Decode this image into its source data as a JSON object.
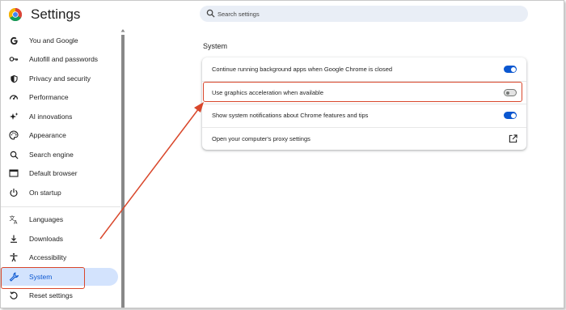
{
  "header": {
    "title": "Settings",
    "search_placeholder": "Search settings"
  },
  "sidebar": {
    "items": [
      {
        "label": "You and Google",
        "icon": "google-g-icon"
      },
      {
        "label": "Autofill and passwords",
        "icon": "key-icon"
      },
      {
        "label": "Privacy and security",
        "icon": "shield-icon"
      },
      {
        "label": "Performance",
        "icon": "speedometer-icon"
      },
      {
        "label": "AI innovations",
        "icon": "sparkle-icon"
      },
      {
        "label": "Appearance",
        "icon": "palette-icon"
      },
      {
        "label": "Search engine",
        "icon": "search-icon"
      },
      {
        "label": "Default browser",
        "icon": "browser-window-icon"
      },
      {
        "label": "On startup",
        "icon": "power-icon"
      },
      {
        "label": "Languages",
        "icon": "translate-icon"
      },
      {
        "label": "Downloads",
        "icon": "download-icon"
      },
      {
        "label": "Accessibility",
        "icon": "accessibility-icon"
      },
      {
        "label": "System",
        "icon": "wrench-icon",
        "active": true
      },
      {
        "label": "Reset settings",
        "icon": "reset-icon"
      }
    ]
  },
  "main": {
    "section_title": "System",
    "rows": [
      {
        "label": "Continue running background apps when Google Chrome is closed",
        "control": "toggle",
        "on": true
      },
      {
        "label": "Use graphics acceleration when available",
        "control": "toggle",
        "on": false
      },
      {
        "label": "Show system notifications about Chrome features and tips",
        "control": "toggle",
        "on": true
      },
      {
        "label": "Open your computer's proxy settings",
        "control": "external-link"
      }
    ]
  },
  "colors": {
    "accent": "#0b57d0",
    "active_nav_bg": "#d3e3fd",
    "annotation": "#d9472b",
    "search_bg": "#e9eef6"
  }
}
